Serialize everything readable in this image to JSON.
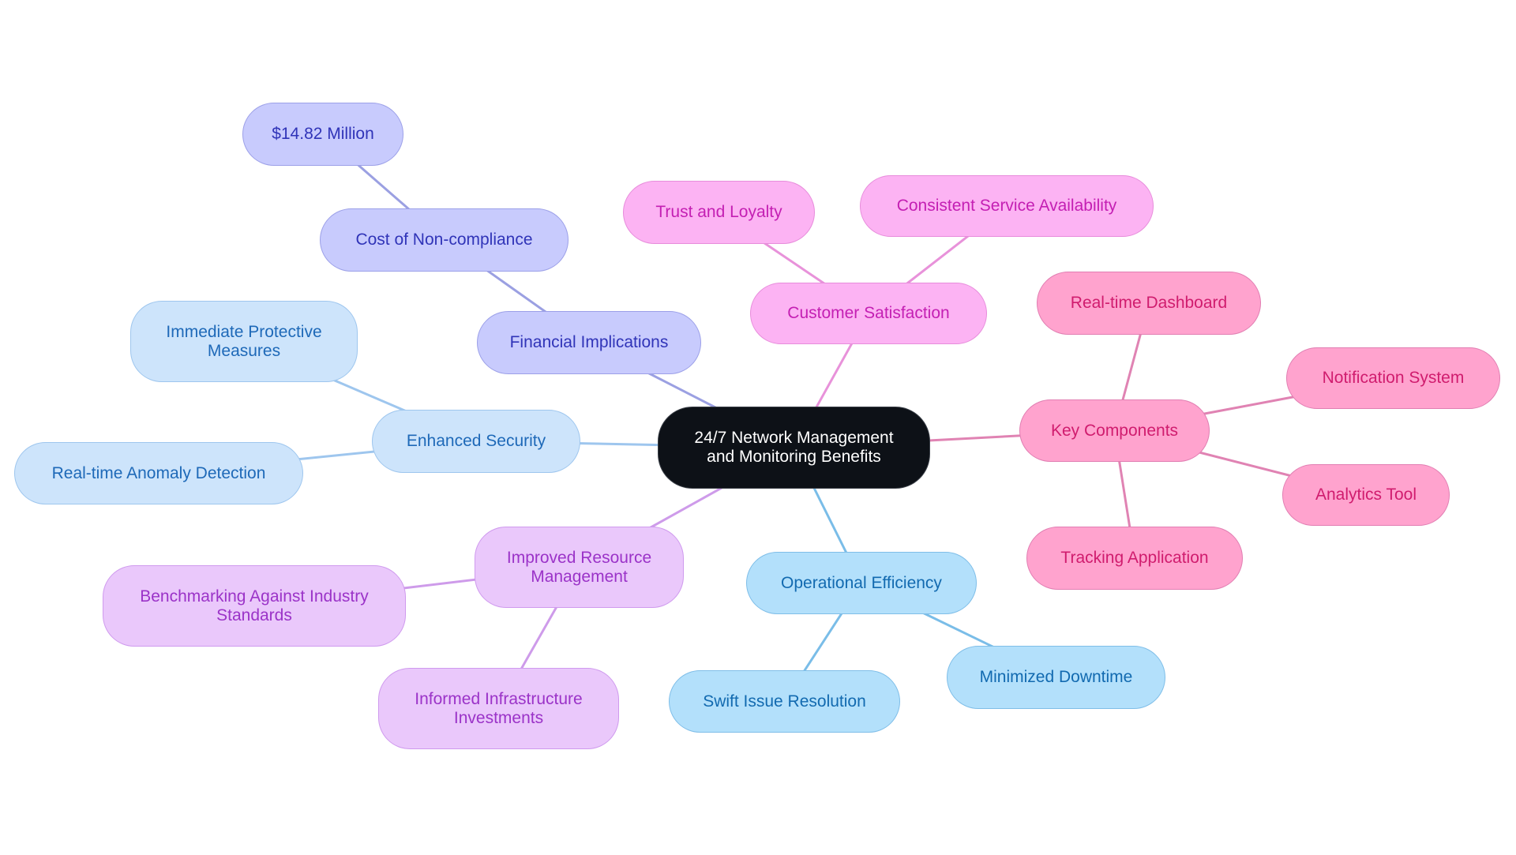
{
  "diagram": {
    "type": "mindmap",
    "center": {
      "label_line1": "24/7 Network Management",
      "label_line2": "and Monitoring Benefits"
    },
    "branch_colors": {
      "financial": {
        "fill": "#c8cbfd",
        "border": "#9ca0e8",
        "text": "#3034b8",
        "edge": "#9ba0e2"
      },
      "security": {
        "fill": "#cde4fb",
        "border": "#9ec6ee",
        "text": "#1e69b8",
        "edge": "#9ec6ee"
      },
      "resource": {
        "fill": "#eac8fb",
        "border": "#cf9aee",
        "text": "#9b33c8",
        "edge": "#ce9bea"
      },
      "operational": {
        "fill": "#b3e0fb",
        "border": "#7fbee8",
        "text": "#126ab0",
        "edge": "#7abde8"
      },
      "customer": {
        "fill": "#fcb3f3",
        "border": "#e78cdb",
        "text": "#c41fb3",
        "edge": "#e892da"
      },
      "key": {
        "fill": "#ffa3ce",
        "border": "#e17eb2",
        "text": "#d01c6e",
        "edge": "#e083b3"
      },
      "center": {
        "fill": "#0d1117",
        "text": "#ffffff"
      }
    },
    "nodes": {
      "financial": {
        "label": "Financial Implications"
      },
      "cost": {
        "label": "Cost of Non-compliance"
      },
      "million": {
        "label": "$14.82 Million"
      },
      "security": {
        "label": "Enhanced Security"
      },
      "immediate": {
        "label_line1": "Immediate Protective",
        "label_line2": "Measures"
      },
      "anomaly": {
        "label": "Real-time Anomaly Detection"
      },
      "resource": {
        "label_line1": "Improved Resource",
        "label_line2": "Management"
      },
      "benchmark": {
        "label_line1": "Benchmarking Against Industry",
        "label_line2": "Standards"
      },
      "informed": {
        "label_line1": "Informed Infrastructure",
        "label_line2": "Investments"
      },
      "operational": {
        "label": "Operational Efficiency"
      },
      "swift": {
        "label": "Swift Issue Resolution"
      },
      "downtime": {
        "label": "Minimized Downtime"
      },
      "customer": {
        "label": "Customer Satisfaction"
      },
      "trust": {
        "label": "Trust and Loyalty"
      },
      "consistent": {
        "label": "Consistent Service Availability"
      },
      "key": {
        "label": "Key Components"
      },
      "dashboard": {
        "label": "Real-time Dashboard"
      },
      "notification": {
        "label": "Notification System"
      },
      "analytics": {
        "label": "Analytics Tool"
      },
      "tracking": {
        "label": "Tracking Application"
      }
    },
    "edges": [
      [
        "center",
        "financial",
        "financial"
      ],
      [
        "financial",
        "cost",
        "financial"
      ],
      [
        "cost",
        "million",
        "financial"
      ],
      [
        "center",
        "security",
        "security"
      ],
      [
        "security",
        "immediate",
        "security"
      ],
      [
        "security",
        "anomaly",
        "security"
      ],
      [
        "center",
        "resource",
        "resource"
      ],
      [
        "resource",
        "benchmark",
        "resource"
      ],
      [
        "resource",
        "informed",
        "resource"
      ],
      [
        "center",
        "operational",
        "operational"
      ],
      [
        "operational",
        "swift",
        "operational"
      ],
      [
        "operational",
        "downtime",
        "operational"
      ],
      [
        "center",
        "customer",
        "customer"
      ],
      [
        "customer",
        "trust",
        "customer"
      ],
      [
        "customer",
        "consistent",
        "customer"
      ],
      [
        "center",
        "key",
        "key"
      ],
      [
        "key",
        "dashboard",
        "key"
      ],
      [
        "key",
        "notification",
        "key"
      ],
      [
        "key",
        "analytics",
        "key"
      ],
      [
        "key",
        "tracking",
        "key"
      ]
    ]
  }
}
